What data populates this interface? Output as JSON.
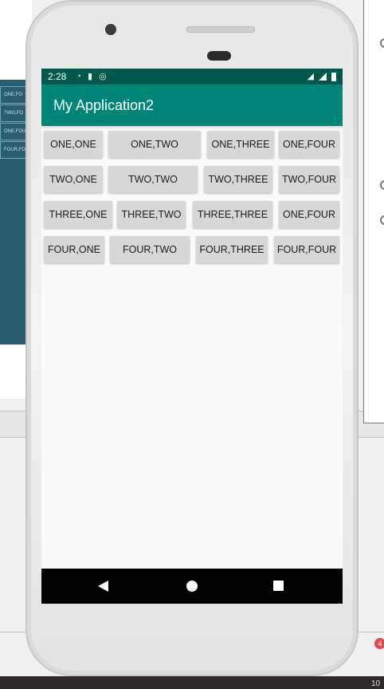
{
  "app": {
    "title": "My Application2"
  },
  "status_bar": {
    "time": "2:28"
  },
  "grid": {
    "rows": [
      [
        "ONE,ONE",
        "ONE,TWO",
        "ONE,THREE",
        "ONE,FOUR"
      ],
      [
        "TWO,ONE",
        "TWO,TWO",
        "TWO,THREE",
        "TWO,FOUR"
      ],
      [
        "THREE,ONE",
        "THREE,TWO",
        "THREE,THREE",
        "ONE,FOUR"
      ],
      [
        "FOUR,ONE",
        "FOUR,TWO",
        "FOUR,THREE",
        "FOUR,FOUR"
      ]
    ]
  },
  "ide": {
    "preview_rows": [
      "ONE,FO",
      "TWO,FO",
      "ONE,FOU",
      "FOUR,FO"
    ],
    "bottom_badge": "4",
    "bottom_text": "10"
  },
  "colors": {
    "status_bar": "#00574b",
    "app_bar": "#008577",
    "button": "#d6d7d7"
  },
  "icons": [
    "wifi-icon",
    "sd-card-icon",
    "sync-icon",
    "signal-icon",
    "battery-icon",
    "back-icon",
    "home-icon",
    "recents-icon"
  ]
}
